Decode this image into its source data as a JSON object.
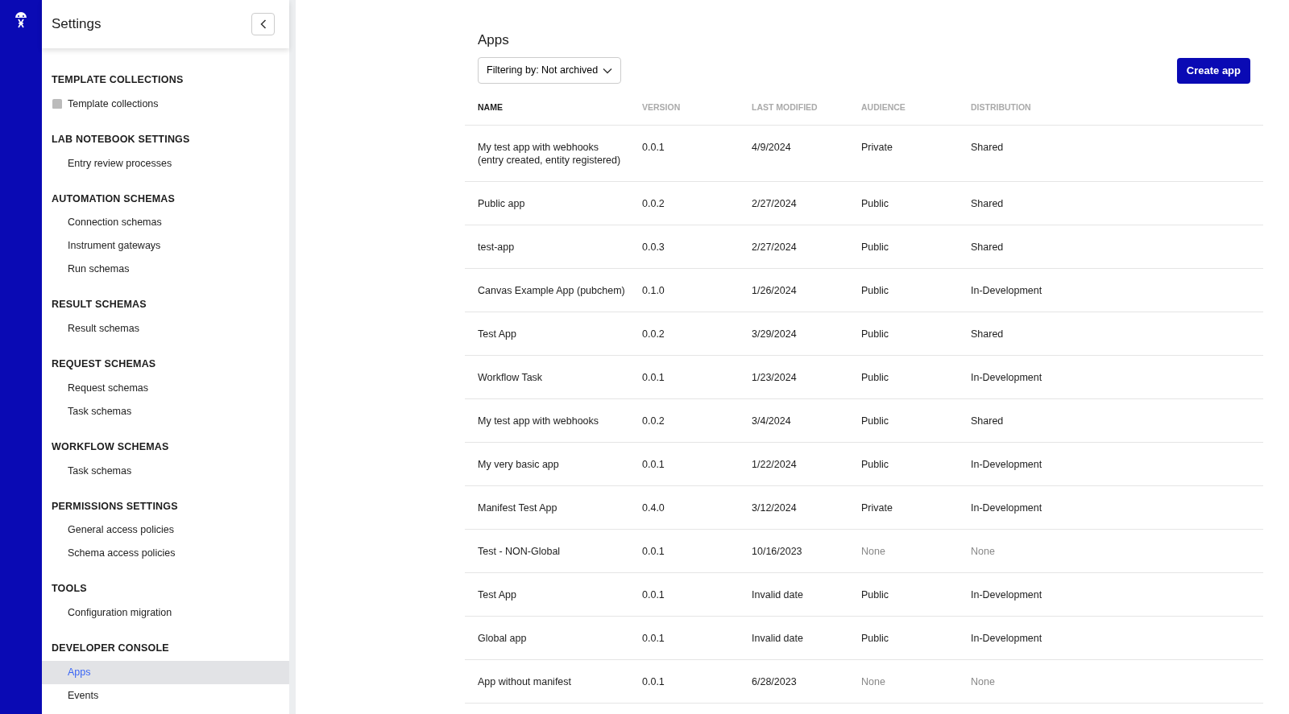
{
  "sidebar": {
    "title": "Settings",
    "sections": [
      {
        "title": "TEMPLATE COLLECTIONS",
        "items": [
          {
            "label": "Template collections",
            "kind": "icon",
            "selected": false
          }
        ]
      },
      {
        "title": "LAB NOTEBOOK SETTINGS",
        "items": [
          {
            "label": "Entry review processes",
            "kind": "plain",
            "selected": false
          }
        ]
      },
      {
        "title": "AUTOMATION SCHEMAS",
        "items": [
          {
            "label": "Connection schemas",
            "kind": "plain",
            "selected": false
          },
          {
            "label": "Instrument gateways",
            "kind": "plain",
            "selected": false
          },
          {
            "label": "Run schemas",
            "kind": "plain",
            "selected": false
          }
        ]
      },
      {
        "title": "RESULT SCHEMAS",
        "items": [
          {
            "label": "Result schemas",
            "kind": "plain",
            "selected": false
          }
        ]
      },
      {
        "title": "REQUEST SCHEMAS",
        "items": [
          {
            "label": "Request schemas",
            "kind": "plain",
            "selected": false
          },
          {
            "label": "Task schemas",
            "kind": "plain",
            "selected": false
          }
        ]
      },
      {
        "title": "WORKFLOW SCHEMAS",
        "items": [
          {
            "label": "Task schemas",
            "kind": "plain",
            "selected": false
          }
        ]
      },
      {
        "title": "PERMISSIONS SETTINGS",
        "items": [
          {
            "label": "General access policies",
            "kind": "plain",
            "selected": false
          },
          {
            "label": "Schema access policies",
            "kind": "plain",
            "selected": false
          }
        ]
      },
      {
        "title": "TOOLS",
        "items": [
          {
            "label": "Configuration migration",
            "kind": "plain",
            "selected": false
          }
        ]
      },
      {
        "title": "DEVELOPER CONSOLE",
        "items": [
          {
            "label": "Apps",
            "kind": "plain",
            "selected": true
          },
          {
            "label": "Events",
            "kind": "plain",
            "selected": false
          }
        ]
      }
    ]
  },
  "page": {
    "title": "Apps",
    "filter": "Filtering by: Not archived",
    "create_button": "Create app"
  },
  "table": {
    "columns": [
      {
        "label": "NAME",
        "sorted": true
      },
      {
        "label": "VERSION",
        "sorted": false
      },
      {
        "label": "LAST MODIFIED",
        "sorted": false
      },
      {
        "label": "AUDIENCE",
        "sorted": false
      },
      {
        "label": "DISTRIBUTION",
        "sorted": false
      }
    ],
    "rows": [
      {
        "name": "My test app with webhooks (entry created, entity registered)",
        "version": "0.0.1",
        "modified": "4/9/2024",
        "audience": {
          "text": "Private",
          "muted": false
        },
        "distribution": {
          "text": "Shared",
          "muted": false
        }
      },
      {
        "name": "Public app",
        "version": "0.0.2",
        "modified": "2/27/2024",
        "audience": {
          "text": "Public",
          "muted": false
        },
        "distribution": {
          "text": "Shared",
          "muted": false
        }
      },
      {
        "name": "test-app",
        "version": "0.0.3",
        "modified": "2/27/2024",
        "audience": {
          "text": "Public",
          "muted": false
        },
        "distribution": {
          "text": "Shared",
          "muted": false
        }
      },
      {
        "name": "Canvas Example App (pubchem)",
        "version": "0.1.0",
        "modified": "1/26/2024",
        "audience": {
          "text": "Public",
          "muted": false
        },
        "distribution": {
          "text": "In-Development",
          "muted": false
        }
      },
      {
        "name": "Test App",
        "version": "0.0.2",
        "modified": "3/29/2024",
        "audience": {
          "text": "Public",
          "muted": false
        },
        "distribution": {
          "text": "Shared",
          "muted": false
        }
      },
      {
        "name": "Workflow Task",
        "version": "0.0.1",
        "modified": "1/23/2024",
        "audience": {
          "text": "Public",
          "muted": false
        },
        "distribution": {
          "text": "In-Development",
          "muted": false
        }
      },
      {
        "name": "My test app with webhooks",
        "version": "0.0.2",
        "modified": "3/4/2024",
        "audience": {
          "text": "Public",
          "muted": false
        },
        "distribution": {
          "text": "Shared",
          "muted": false
        }
      },
      {
        "name": "My very basic app",
        "version": "0.0.1",
        "modified": "1/22/2024",
        "audience": {
          "text": "Public",
          "muted": false
        },
        "distribution": {
          "text": "In-Development",
          "muted": false
        }
      },
      {
        "name": "Manifest Test App",
        "version": "0.4.0",
        "modified": "3/12/2024",
        "audience": {
          "text": "Private",
          "muted": false
        },
        "distribution": {
          "text": "In-Development",
          "muted": false
        }
      },
      {
        "name": "Test - NON-Global",
        "version": "0.0.1",
        "modified": "10/16/2023",
        "audience": {
          "text": "None",
          "muted": true
        },
        "distribution": {
          "text": "None",
          "muted": true
        }
      },
      {
        "name": "Test App",
        "version": "0.0.1",
        "modified": "Invalid date",
        "audience": {
          "text": "Public",
          "muted": false
        },
        "distribution": {
          "text": "In-Development",
          "muted": false
        }
      },
      {
        "name": "Global app",
        "version": "0.0.1",
        "modified": "Invalid date",
        "audience": {
          "text": "Public",
          "muted": false
        },
        "distribution": {
          "text": "In-Development",
          "muted": false
        }
      },
      {
        "name": "App without manifest",
        "version": "0.0.1",
        "modified": "6/28/2023",
        "audience": {
          "text": "None",
          "muted": true
        },
        "distribution": {
          "text": "None",
          "muted": true
        }
      }
    ]
  }
}
